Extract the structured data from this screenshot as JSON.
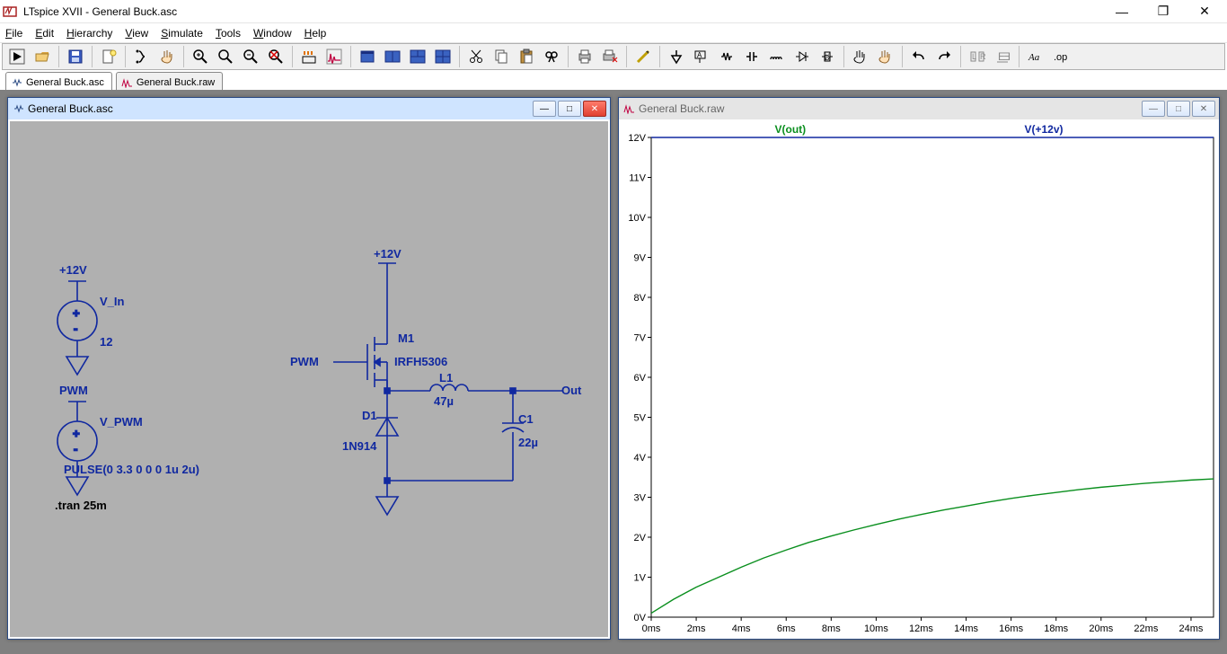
{
  "window": {
    "title": "LTspice XVII - General Buck.asc"
  },
  "menu": {
    "file": "File",
    "edit": "Edit",
    "hierarchy": "Hierarchy",
    "view": "View",
    "simulate": "Simulate",
    "tools": "Tools",
    "window": "Window",
    "help": "Help"
  },
  "tabs": {
    "asc": "General Buck.asc",
    "raw": "General Buck.raw"
  },
  "toolbar_names": [
    "run",
    "open",
    "save",
    "new-schematic",
    "simulate",
    "pan",
    "zoom-in",
    "zoom-out",
    "zoom-area",
    "zoom-full",
    "autorange",
    "graph",
    "step-back",
    "color1",
    "color2",
    "color3",
    "color4",
    "cut",
    "copy",
    "paste",
    "find",
    "print",
    "print-preview",
    "edit",
    "ground",
    "component",
    "wire",
    "resistor",
    "capacitor",
    "inductor",
    "diode",
    "gnd2",
    "node",
    "label",
    "rotate",
    "mirror",
    "undo",
    "redo",
    "move",
    "drag",
    "text",
    "op"
  ],
  "child_asc": {
    "title": "General Buck.asc"
  },
  "child_raw": {
    "title": "General Buck.raw"
  },
  "schematic": {
    "labels": {
      "net_12v_left": "+12V",
      "v_in": "V_In",
      "v_in_val": "12",
      "net_pwm_left": "PWM",
      "v_pwm": "V_PWM",
      "pulse": "PULSE(0 3.3 0 0 0 1u 2u)",
      "tran": ".tran 25m",
      "net_12v_top": "+12V",
      "m1": "M1",
      "m1_model": "IRFH5306",
      "pwm_net": "PWM",
      "l1": "L1",
      "l1_val": "47µ",
      "out": "Out",
      "d1": "D1",
      "d1_model": "1N914",
      "c1": "C1",
      "c1_val": "22µ"
    }
  },
  "chart_data": {
    "type": "line",
    "title": "",
    "xlabel": "",
    "ylabel": "",
    "xlim": [
      0,
      25
    ],
    "ylim": [
      0,
      12
    ],
    "x_ticks": [
      "0ms",
      "2ms",
      "4ms",
      "6ms",
      "8ms",
      "10ms",
      "12ms",
      "14ms",
      "16ms",
      "18ms",
      "20ms",
      "22ms",
      "24ms"
    ],
    "y_ticks": [
      "0V",
      "1V",
      "2V",
      "3V",
      "4V",
      "5V",
      "6V",
      "7V",
      "8V",
      "9V",
      "10V",
      "11V",
      "12V"
    ],
    "legend": [
      "V(out)",
      "V(+12v)"
    ],
    "series": [
      {
        "name": "V(out)",
        "color": "#0a8f1e",
        "x": [
          0,
          1,
          2,
          3,
          4,
          5,
          6,
          7,
          8,
          9,
          10,
          11,
          12,
          13,
          14,
          15,
          16,
          17,
          18,
          19,
          20,
          21,
          22,
          23,
          24,
          25
        ],
        "y": [
          0.1,
          0.45,
          0.75,
          1.0,
          1.25,
          1.48,
          1.68,
          1.87,
          2.03,
          2.18,
          2.32,
          2.45,
          2.57,
          2.68,
          2.78,
          2.88,
          2.97,
          3.05,
          3.12,
          3.19,
          3.25,
          3.3,
          3.35,
          3.39,
          3.43,
          3.46
        ]
      },
      {
        "name": "V(+12v)",
        "color": "#1028a0",
        "x": [
          0,
          25
        ],
        "y": [
          12,
          12
        ]
      }
    ]
  }
}
